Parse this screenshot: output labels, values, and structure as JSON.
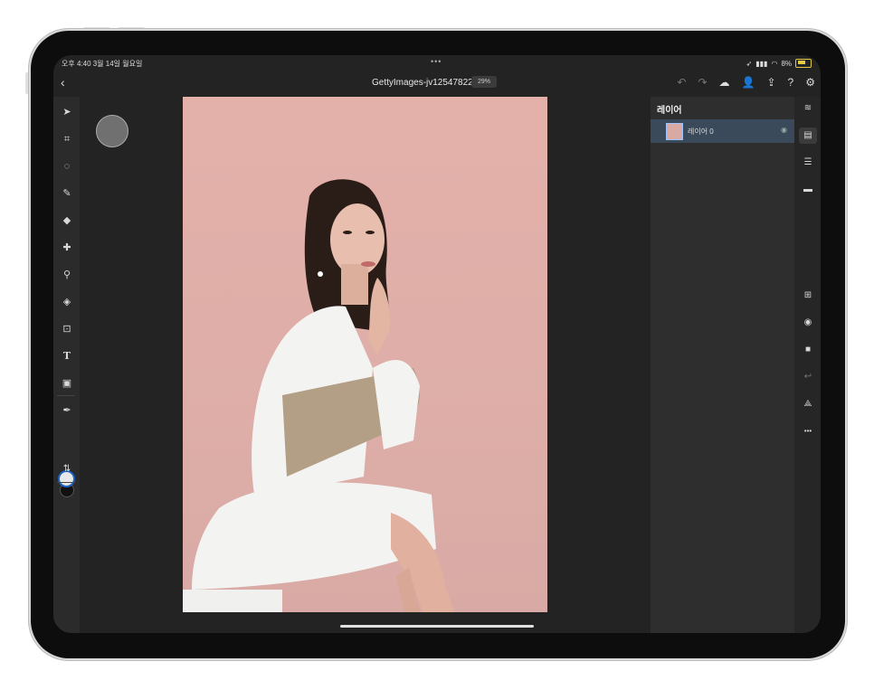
{
  "status": {
    "time": "오후 4:40  3월 14일 월요일",
    "dots": "•••",
    "battery": "8%"
  },
  "topbar": {
    "title": "GettyImages-jv12547822",
    "zoom": "29%"
  },
  "icons": {
    "back": "‹",
    "undo": "↶",
    "redo": "↷",
    "cloud": "☁",
    "add_user": "👤",
    "share": "⇪",
    "help": "?",
    "settings": "⚙"
  },
  "tools": [
    {
      "name": "select-tool",
      "glyph": "➤"
    },
    {
      "name": "transform-tool",
      "glyph": "⌗"
    },
    {
      "name": "lasso-tool",
      "glyph": "◌"
    },
    {
      "name": "brush-tool",
      "glyph": "✎"
    },
    {
      "name": "eraser-tool",
      "glyph": "◆"
    },
    {
      "name": "heal-tool",
      "glyph": "✚"
    },
    {
      "name": "clone-tool",
      "glyph": "⚲"
    },
    {
      "name": "fill-tool",
      "glyph": "◈"
    },
    {
      "name": "crop-tool",
      "glyph": "⊡"
    },
    {
      "name": "type-tool",
      "glyph": "T"
    },
    {
      "name": "image-tool",
      "glyph": "▣"
    },
    {
      "name": "eyedropper-tool",
      "glyph": "✒"
    },
    {
      "name": "swap-tool",
      "glyph": "⇅"
    }
  ],
  "layers_panel": {
    "title": "레이어",
    "layers": [
      {
        "name": "레이어 0",
        "eye": "◉"
      }
    ]
  },
  "rightbar": [
    "≋",
    "▤",
    "☰",
    "▬",
    "⊞",
    "◉",
    "■",
    "↩",
    "⟁",
    "•••"
  ]
}
